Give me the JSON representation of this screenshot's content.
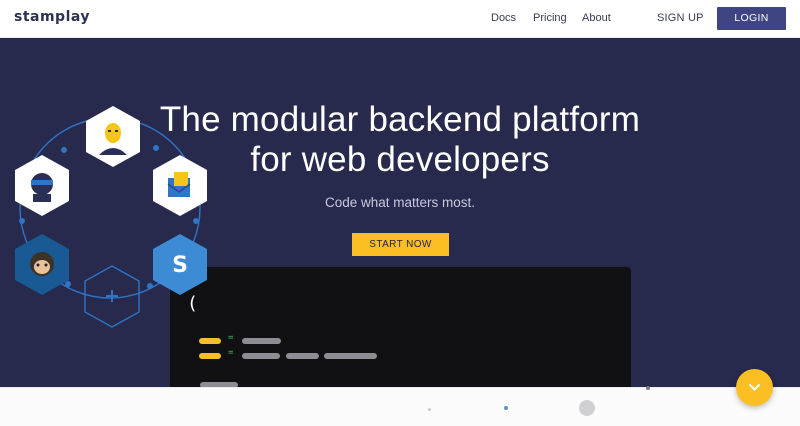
{
  "header": {
    "logo": "stamplay",
    "nav": {
      "docs": "Docs",
      "pricing": "Pricing",
      "about": "About"
    },
    "signup": "SIGN UP",
    "login": "LOGIN"
  },
  "hero": {
    "title_line1": "The modular backend platform",
    "title_line2": "for web developers",
    "subtitle": "Code what matters most.",
    "cta": "START NOW"
  },
  "code_window": {
    "paren": "(",
    "equals": "="
  },
  "icons": {
    "scroll": "chevron-down-icon",
    "hexagons": [
      "user-avatar-icon",
      "email-icon",
      "stamplay-s-icon",
      "add-icon",
      "mailchimp-icon",
      "ninja-icon"
    ]
  },
  "colors": {
    "nav_bg": "#ffffff",
    "hero_bg": "#272a4c",
    "accent": "#fbbf24",
    "login_bg": "#3e4582",
    "code_bg": "#111114"
  }
}
